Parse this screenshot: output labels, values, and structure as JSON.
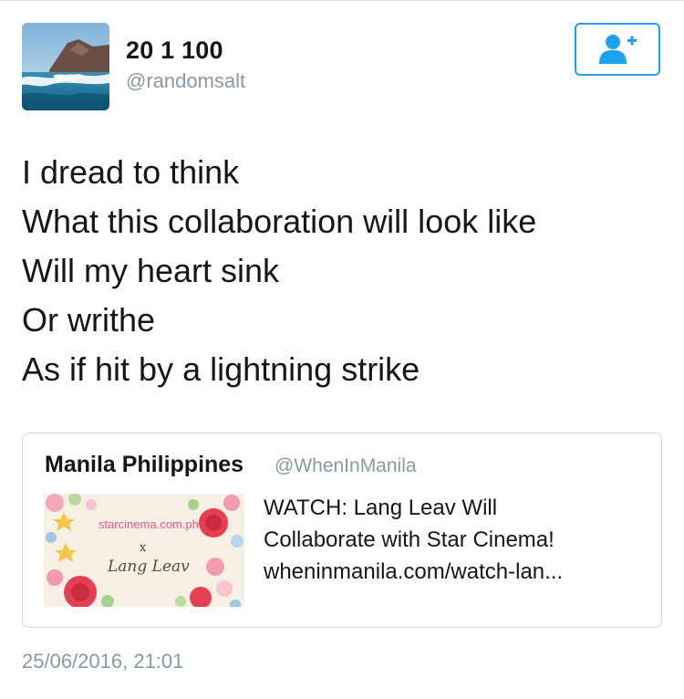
{
  "user": {
    "display_name": "20 1 100",
    "handle": "@randomsalt",
    "avatar_icon": "avatar-coastal-photo"
  },
  "follow_button": {
    "icon": "follow-user-plus-icon",
    "color": "#1da1f2"
  },
  "tweet": {
    "lines": [
      "I dread to think",
      "What this collaboration will look like",
      "Will my heart sink",
      "Or writhe",
      "As if hit by a lightning strike"
    ]
  },
  "quote": {
    "name": "Manila Philippines",
    "handle": "@WhenInManila",
    "thumbnail": {
      "brand": "starcinema.com.ph",
      "separator": "x",
      "author": "Lang Leav"
    },
    "title_lines": [
      "WATCH: Lang Leav Will",
      "Collaborate with Star Cinema!",
      "wheninmanila.com/watch-lan..."
    ]
  },
  "timestamp": "25/06/2016, 21:01",
  "colors": {
    "text": "#14171a",
    "muted": "#8899a6",
    "accent": "#1da1f2",
    "border": "#cfd9de"
  }
}
